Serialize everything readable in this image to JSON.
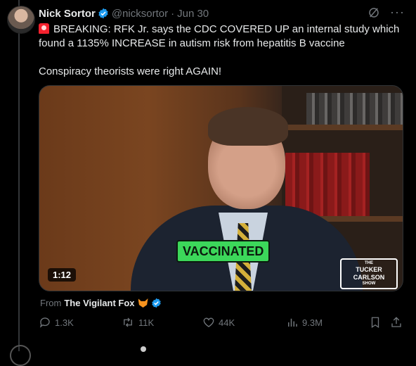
{
  "author": {
    "name": "Nick Sortor",
    "handle": "@nicksortor",
    "separator": "·",
    "date": "Jun 30"
  },
  "post": {
    "line1": "BREAKING: RFK Jr. says the CDC COVERED UP an internal study which found a 1135% INCREASE in autism risk from hepatitis B vaccine",
    "line2": "Conspiracy theorists were right AGAIN!"
  },
  "media": {
    "caption": "VACCINATED",
    "duration": "1:12",
    "logo_lines": [
      "THE",
      "TUCKER",
      "CARLSON",
      "SHOW"
    ]
  },
  "source": {
    "prefix": "From",
    "name": "The Vigilant Fox"
  },
  "actions": {
    "replies": "1.3K",
    "reposts": "11K",
    "likes": "44K",
    "views": "9.3M"
  },
  "icons": [
    "verified-icon",
    "grok-icon",
    "more-icon",
    "siren-icon",
    "fox-icon",
    "reply-icon",
    "repost-icon",
    "like-icon",
    "views-icon",
    "bookmark-icon",
    "share-icon"
  ],
  "colors": {
    "background": "#000000",
    "text": "#e7e9ea",
    "muted": "#71767b",
    "verified": "#1d9bf0",
    "caption_bg": "#3cd75a"
  }
}
